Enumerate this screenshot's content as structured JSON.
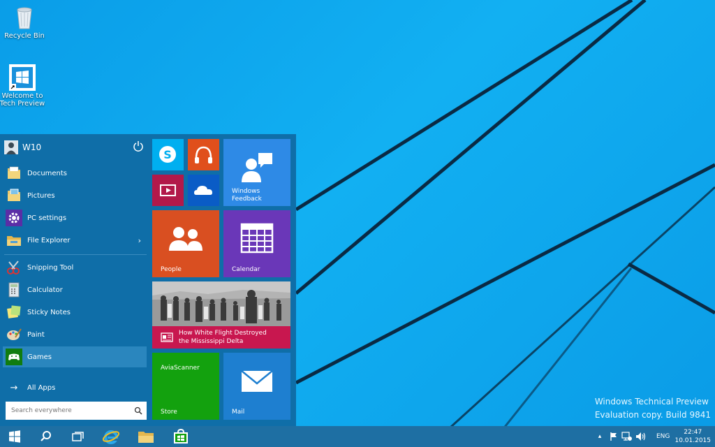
{
  "desktop": {
    "icons": [
      {
        "label": "Recycle Bin"
      },
      {
        "label_line1": "Welcome to",
        "label_line2": "Tech Preview"
      }
    ],
    "watermark": {
      "line1": "Windows Technical Preview",
      "line2": "Evaluation copy. Build 9841"
    }
  },
  "start_menu": {
    "user": {
      "name": "W10"
    },
    "places": [
      {
        "label": "Documents"
      },
      {
        "label": "Pictures"
      },
      {
        "label": "PC settings"
      },
      {
        "label": "File Explorer"
      }
    ],
    "apps": [
      {
        "label": "Snipping Tool"
      },
      {
        "label": "Calculator"
      },
      {
        "label": "Sticky Notes"
      },
      {
        "label": "Paint"
      },
      {
        "label": "Games"
      }
    ],
    "all_apps": "All Apps",
    "search_placeholder": "Search everywhere",
    "tiles": {
      "windows_feedback": {
        "line1": "Windows",
        "line2": "Feedback"
      },
      "people": "People",
      "calendar": "Calendar",
      "news": {
        "line1": "How White Flight Destroyed",
        "line2": "the Mississippi Delta"
      },
      "store": {
        "top": "AviaScanner",
        "bottom": "Store"
      },
      "mail": "Mail"
    },
    "colors": {
      "menu_bg": "#0f6ea8",
      "accent": "#1e6fa3"
    }
  },
  "taskbar": {
    "lang": "ENG",
    "time": "22:47",
    "date": "10.01.2015"
  }
}
